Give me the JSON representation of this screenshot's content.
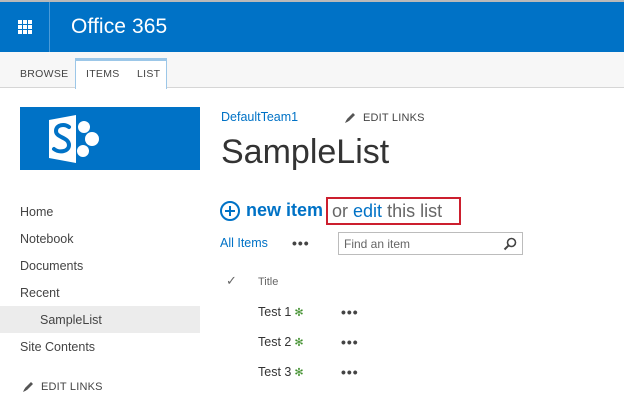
{
  "suite": {
    "title": "Office 365"
  },
  "ribbon": {
    "tabs": [
      {
        "label": "BROWSE",
        "active": false
      },
      {
        "label": "ITEMS",
        "active": true
      },
      {
        "label": "LIST",
        "active": true
      }
    ]
  },
  "nav": {
    "items": [
      {
        "label": "Home"
      },
      {
        "label": "Notebook"
      },
      {
        "label": "Documents"
      },
      {
        "label": "Recent"
      },
      {
        "label": "SampleList",
        "current": true
      },
      {
        "label": "Site Contents"
      }
    ],
    "edit_links": "EDIT LINKS"
  },
  "header": {
    "site_link": "DefaultTeam1",
    "edit_links": "EDIT LINKS",
    "page_title": "SampleList"
  },
  "actions": {
    "new_item": "new item",
    "or_text": "or",
    "edit_text": "edit",
    "this_list": "this list"
  },
  "view": {
    "name": "All Items",
    "more": "•••"
  },
  "search": {
    "placeholder": "Find an item"
  },
  "list": {
    "check_glyph": "✓",
    "columns": [
      "Title"
    ],
    "rows": [
      {
        "title": "Test 1",
        "badge": "✻",
        "more": "•••"
      },
      {
        "title": "Test 2",
        "badge": "✻",
        "more": "•••"
      },
      {
        "title": "Test 3",
        "badge": "✻",
        "more": "•••"
      }
    ]
  },
  "icons": {
    "app_launcher": "waffle-icon",
    "sharepoint_logo": "sharepoint-logo-icon",
    "edit": "pencil-icon",
    "add": "plus-circle-icon",
    "search": "search-icon",
    "new_item_badge": "new-badge-icon"
  },
  "colors": {
    "suite_bar": "#0072c6",
    "link": "#0072c6",
    "highlight_box": "#cc1f2e",
    "new_badge": "#3e8e2a"
  }
}
